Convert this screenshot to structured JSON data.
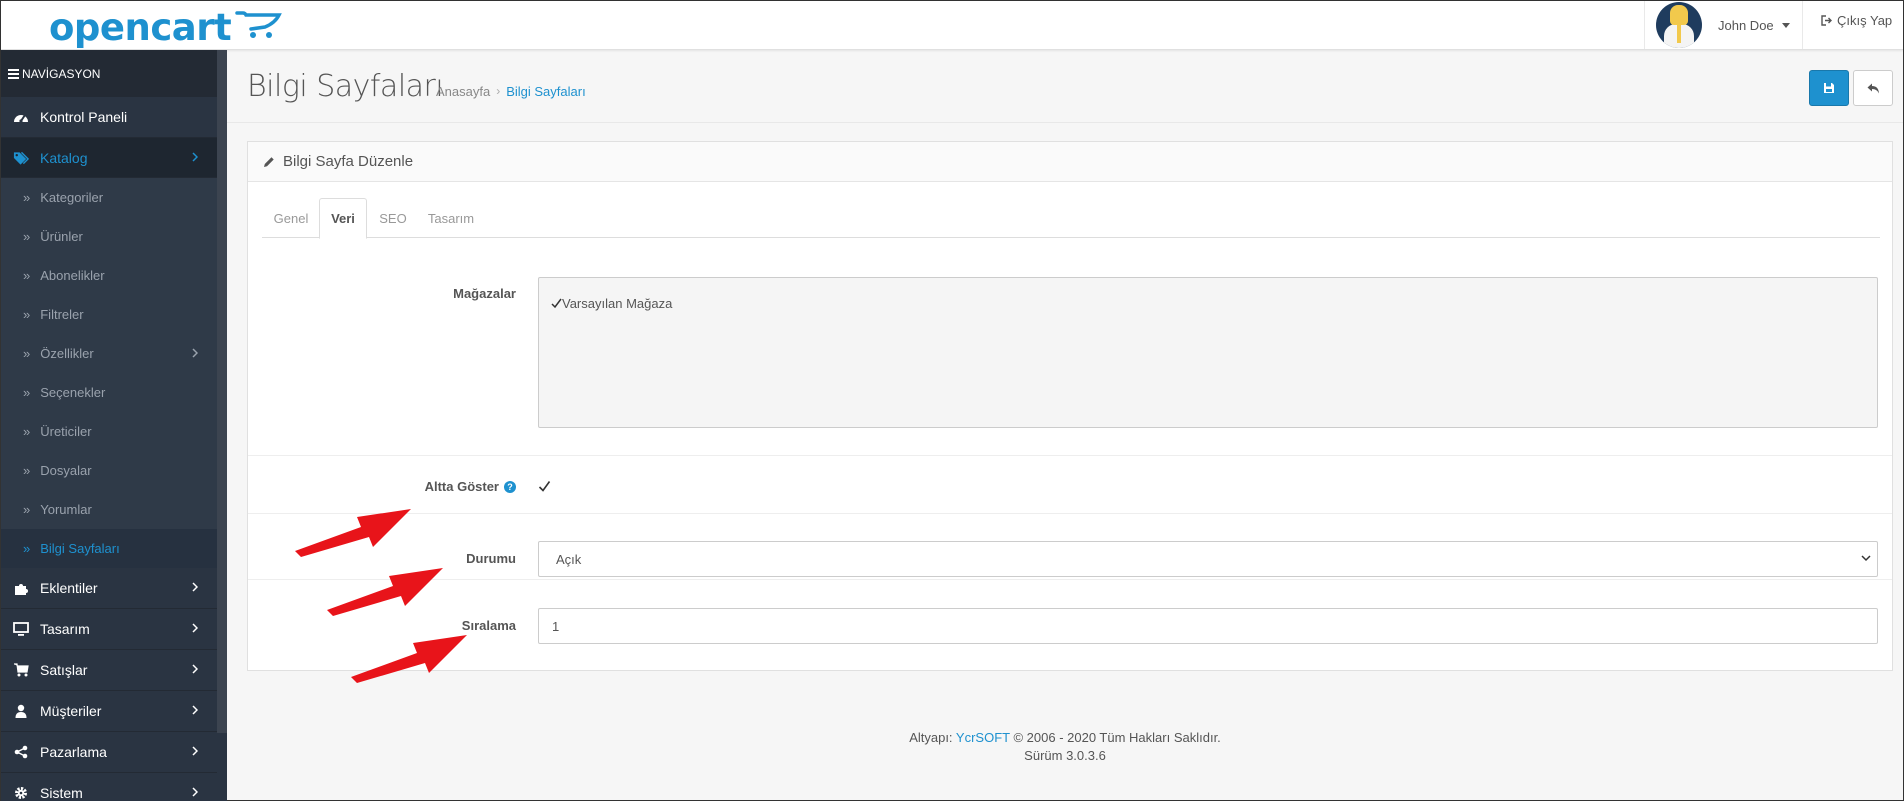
{
  "app": {
    "logo_text": "opencart"
  },
  "header": {
    "user_name": "John Doe",
    "logout_label": "Çıkış Yap"
  },
  "sidebar": {
    "heading": "NAVİGASYON",
    "items": [
      {
        "label": "Kontrol Paneli",
        "icon": "dashboard-icon"
      },
      {
        "label": "Katalog",
        "icon": "tags-icon",
        "active": true
      },
      {
        "label": "Eklentiler",
        "icon": "puzzle-icon"
      },
      {
        "label": "Tasarım",
        "icon": "desktop-icon"
      },
      {
        "label": "Satışlar",
        "icon": "cart-icon"
      },
      {
        "label": "Müşteriler",
        "icon": "user-icon"
      },
      {
        "label": "Pazarlama",
        "icon": "share-icon"
      },
      {
        "label": "Sistem",
        "icon": "cog-icon"
      }
    ],
    "catalog_sub": [
      {
        "label": "Kategoriler"
      },
      {
        "label": "Ürünler"
      },
      {
        "label": "Abonelikler"
      },
      {
        "label": "Filtreler"
      },
      {
        "label": "Özellikler"
      },
      {
        "label": "Seçenekler"
      },
      {
        "label": "Üreticiler"
      },
      {
        "label": "Dosyalar"
      },
      {
        "label": "Yorumlar"
      },
      {
        "label": "Bilgi Sayfaları"
      }
    ]
  },
  "page": {
    "title": "Bilgi Sayfaları",
    "breadcrumb_home": "Anasayfa",
    "breadcrumb_sep": "›",
    "breadcrumb_current": "Bilgi Sayfaları",
    "panel_title": "Bilgi Sayfa Düzenle"
  },
  "tabs": [
    {
      "label": "Genel"
    },
    {
      "label": "Veri",
      "active": true
    },
    {
      "label": "SEO"
    },
    {
      "label": "Tasarım"
    }
  ],
  "form": {
    "stores_label": "Mağazalar",
    "store_option": "Varsayılan Mağaza",
    "store_checked": true,
    "bottom_label": "Altta Göster",
    "bottom_checked": true,
    "help_char": "?",
    "status_label": "Durumu",
    "status_value": "Açık",
    "sort_label": "Sıralama",
    "sort_value": "1"
  },
  "footer": {
    "prefix": "Altyapı: ",
    "brand": "YcrSOFT",
    "rights": " © 2006 - 2020 Tüm Hakları Saklıdır.",
    "version": "Sürüm 3.0.3.6"
  },
  "colors": {
    "accent": "#1e91cf",
    "sidebar_bg": "#2a3442",
    "annotation_arrow": "#e8141a"
  }
}
